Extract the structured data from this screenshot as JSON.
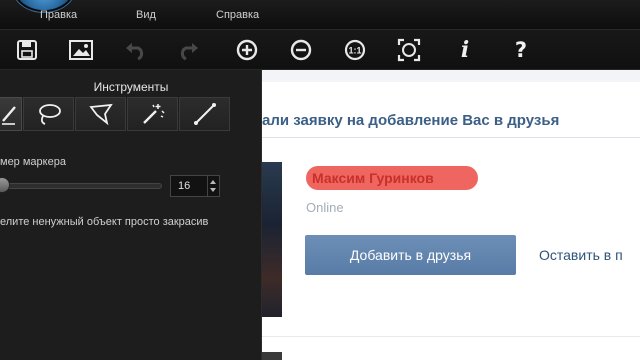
{
  "menubar": {
    "items": [
      {
        "label": "Правка"
      },
      {
        "label": "Вид"
      },
      {
        "label": "Справка"
      }
    ]
  },
  "toolbar": {
    "buttons": [
      {
        "icon": "save-icon"
      },
      {
        "icon": "image-icon"
      },
      {
        "icon": "undo-icon",
        "disabled": true
      },
      {
        "icon": "redo-icon",
        "disabled": true
      },
      {
        "icon": "zoom-in-icon"
      },
      {
        "icon": "zoom-out-icon"
      },
      {
        "icon": "actual-size-icon",
        "label": "1:1"
      },
      {
        "icon": "fit-to-window-icon"
      },
      {
        "icon": "info-icon",
        "label": "i"
      },
      {
        "icon": "help-icon",
        "label": "?"
      }
    ]
  },
  "tools_panel": {
    "title": "Инструменты",
    "tools": [
      "marker-icon",
      "lasso-icon",
      "polygon-lasso-icon",
      "magic-wand-icon",
      "line-icon"
    ],
    "marker_size_label": "мер маркера",
    "marker_size_value": "16",
    "marker_size_fraction": 0.0,
    "hint": "елите ненужный объект просто закрасив"
  },
  "web_page": {
    "request_title": "али заявку на добавление Вас в друзья",
    "user_name": "Максим Гуринков",
    "user_status": "Online",
    "add_friend_button": "Добавить в друзья",
    "leave_link": "Оставить в п"
  },
  "colors": {
    "panel_bg": "#1d1d1d",
    "accent_button": "#5e80aa",
    "highlight_mark": "#ee5d56",
    "title_blue": "#3b5f86"
  }
}
